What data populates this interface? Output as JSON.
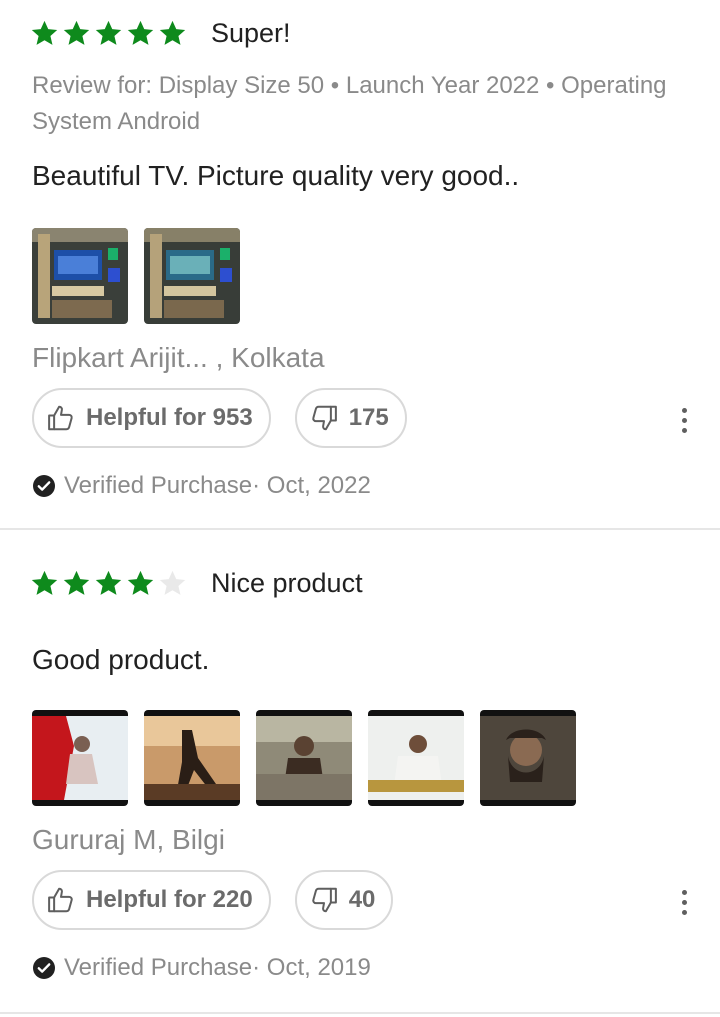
{
  "reviews": [
    {
      "rating": 5,
      "title": "Super!",
      "variant": "Review for: Display Size 50 • Launch Year 2022 • Operating System Android",
      "body": "Beautiful TV. Picture quality very good..",
      "photo_count": 2,
      "reviewer": "Flipkart Arijit... , Kolkata",
      "helpful_label": "Helpful for 953",
      "dislike_count": "175",
      "verified": "Verified Purchase",
      "date": "· Oct, 2022"
    },
    {
      "rating": 4,
      "title": "Nice product",
      "body": "Good product.",
      "photo_count": 5,
      "reviewer": "Gururaj M, Bilgi",
      "helpful_label": "Helpful for 220",
      "dislike_count": "40",
      "verified": "Verified Purchase",
      "date": "· Oct, 2019"
    }
  ],
  "icons": {
    "star_filled": "star-filled-icon",
    "star_empty": "star-empty-icon",
    "thumbs_up": "thumbs-up-icon",
    "thumbs_down": "thumbs-down-icon",
    "more": "more-vertical-icon",
    "verified": "verified-check-icon"
  },
  "colors": {
    "star": "#0e8a1c",
    "star_empty": "#e9e9e9",
    "muted_text": "#8a8a8a",
    "primary_text": "#212121",
    "divider": "#e6e6e6"
  }
}
